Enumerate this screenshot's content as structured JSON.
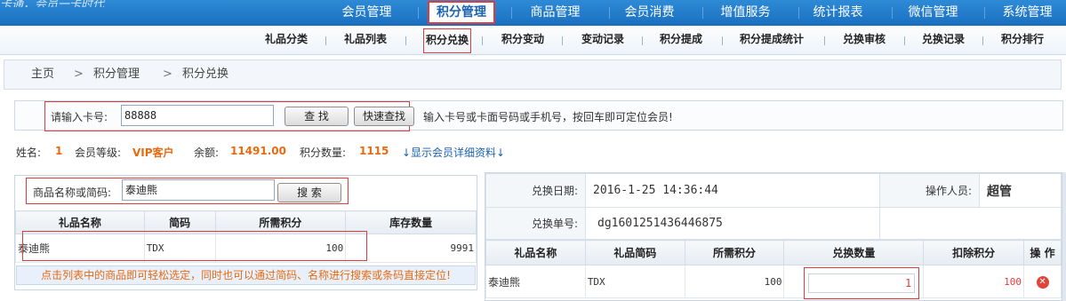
{
  "top_nav": {
    "items": [
      "会员管理",
      "积分管理",
      "商品管理",
      "会员消费",
      "增值服务",
      "统计报表",
      "微信管理",
      "系统管理"
    ],
    "active_index": 1
  },
  "sub_nav": {
    "items": [
      "礼品分类",
      "礼品列表",
      "积分兑换",
      "积分变动",
      "变动记录",
      "积分提成",
      "积分提成统计",
      "兑换审核",
      "兑换记录",
      "积分排行"
    ],
    "active_index": 2
  },
  "breadcrumb": {
    "home": "主页",
    "sep": ">",
    "level1": "积分管理",
    "level2": "积分兑换"
  },
  "card_search": {
    "label": "请输入卡号:",
    "value": "88888",
    "search_button": "查  找",
    "quick_search_button": "快速查找",
    "hint": "输入卡号或卡面号码或手机号，按回车即可定位会员!"
  },
  "member": {
    "name_label": "姓名:",
    "name": "1",
    "level_label": "会员等级:",
    "level": "VIP客户",
    "balance_label": "余额:",
    "balance": "11491.00",
    "points_label": "积分数量:",
    "points": "1115",
    "detail_link": "↓显示会员详细资料↓"
  },
  "gift_search": {
    "label": "商品名称或简码:",
    "value": "泰迪熊",
    "button": "搜  索"
  },
  "gift_table": {
    "headers": [
      "礼品名称",
      "简码",
      "所需积分",
      "库存数量"
    ],
    "rows": [
      {
        "name": "泰迪熊",
        "code": "TDX",
        "points": "100",
        "stock": "9991"
      }
    ],
    "tip": "点击列表中的商品即可轻松选定，同时也可以通过简码、名称进行搜索或条码直接定位!"
  },
  "exchange": {
    "date_label": "兑换日期:",
    "date": "2016-1-25 14:36:44",
    "operator_label": "操作人员:",
    "operator": "超管",
    "order_label": "兑换单号:",
    "order_no": "dg1601251436446875",
    "headers": [
      "礼品名称",
      "礼品简码",
      "所需积分",
      "兑换数量",
      "扣除积分",
      "操 作"
    ],
    "rows": [
      {
        "name": "泰迪熊",
        "code": "TDX",
        "points": "100",
        "qty": "1",
        "deduct": "100"
      }
    ]
  },
  "colors": {
    "nav_blue": "#2173c4",
    "highlight_red": "#e23b3b",
    "accent_orange": "#e86a10"
  }
}
